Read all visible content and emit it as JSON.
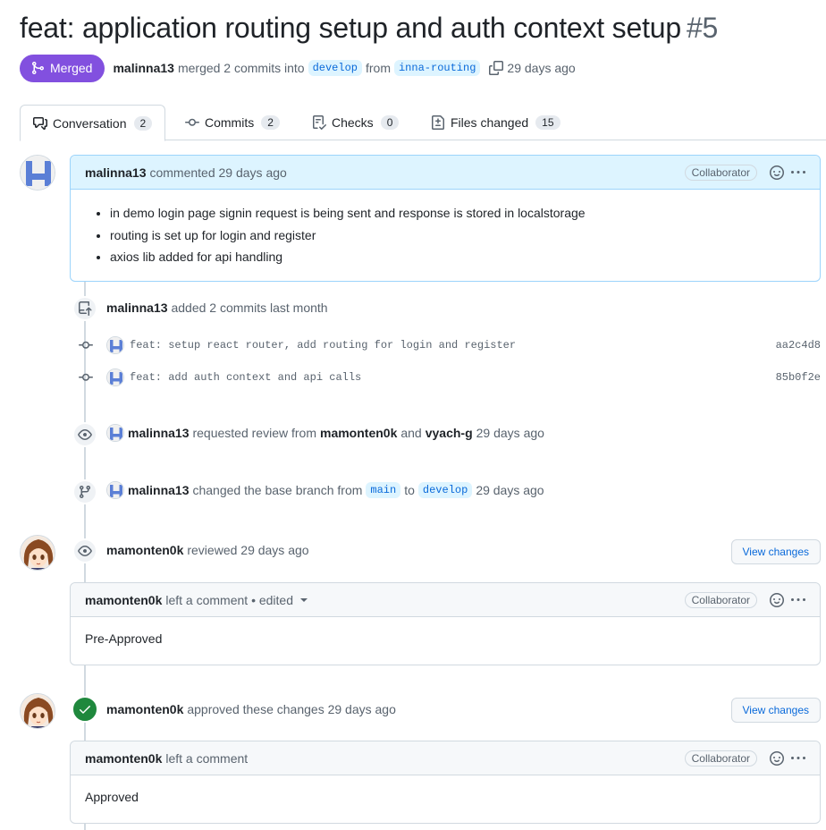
{
  "header": {
    "title": "feat: application routing setup and auth context setup",
    "number": "#5",
    "state_label": "Merged",
    "author": "malinna13",
    "merge_text": "merged 2 commits into",
    "base_branch": "develop",
    "from_text": "from",
    "head_branch": "inna-routing",
    "time": "29 days ago"
  },
  "tabs": [
    {
      "label": "Conversation",
      "count": "2"
    },
    {
      "label": "Commits",
      "count": "2"
    },
    {
      "label": "Checks",
      "count": "0"
    },
    {
      "label": "Files changed",
      "count": "15"
    }
  ],
  "first_comment": {
    "author": "malinna13",
    "action": "commented 29 days ago",
    "badge": "Collaborator",
    "items": [
      "in demo login page signin request is being sent and response is stored in localstorage",
      "routing is set up for login and register",
      "axios lib added for api handling"
    ]
  },
  "commits_event": {
    "author": "malinna13",
    "text": "added 2 commits last month",
    "commits": [
      {
        "message": "feat: setup react router, add routing for login and register",
        "sha": "aa2c4d8"
      },
      {
        "message": "feat: add auth context and api calls",
        "sha": "85b0f2e"
      }
    ]
  },
  "review_request": {
    "author": "malinna13",
    "text": "requested review from",
    "reviewer1": "mamonten0k",
    "and_text": "and",
    "reviewer2": "vyach-g",
    "time": "29 days ago"
  },
  "base_change": {
    "author": "malinna13",
    "text": "changed the base branch from",
    "from_branch": "main",
    "to_text": "to",
    "to_branch": "develop",
    "time": "29 days ago"
  },
  "review1": {
    "author": "mamonten0k",
    "text": "reviewed 29 days ago",
    "button": "View changes",
    "comment_author": "mamonten0k",
    "comment_text": "left a comment • edited",
    "badge": "Collaborator",
    "body": "Pre-Approved"
  },
  "review2": {
    "author": "mamonten0k",
    "text": "approved these changes 29 days ago",
    "button": "View changes",
    "comment_author": "mamonten0k",
    "comment_text": "left a comment",
    "badge": "Collaborator",
    "body": "Approved"
  },
  "colors": {
    "merged": "#8250df",
    "branch_bg": "#ddf4ff",
    "link": "#0969da",
    "approved": "#1f883d"
  }
}
